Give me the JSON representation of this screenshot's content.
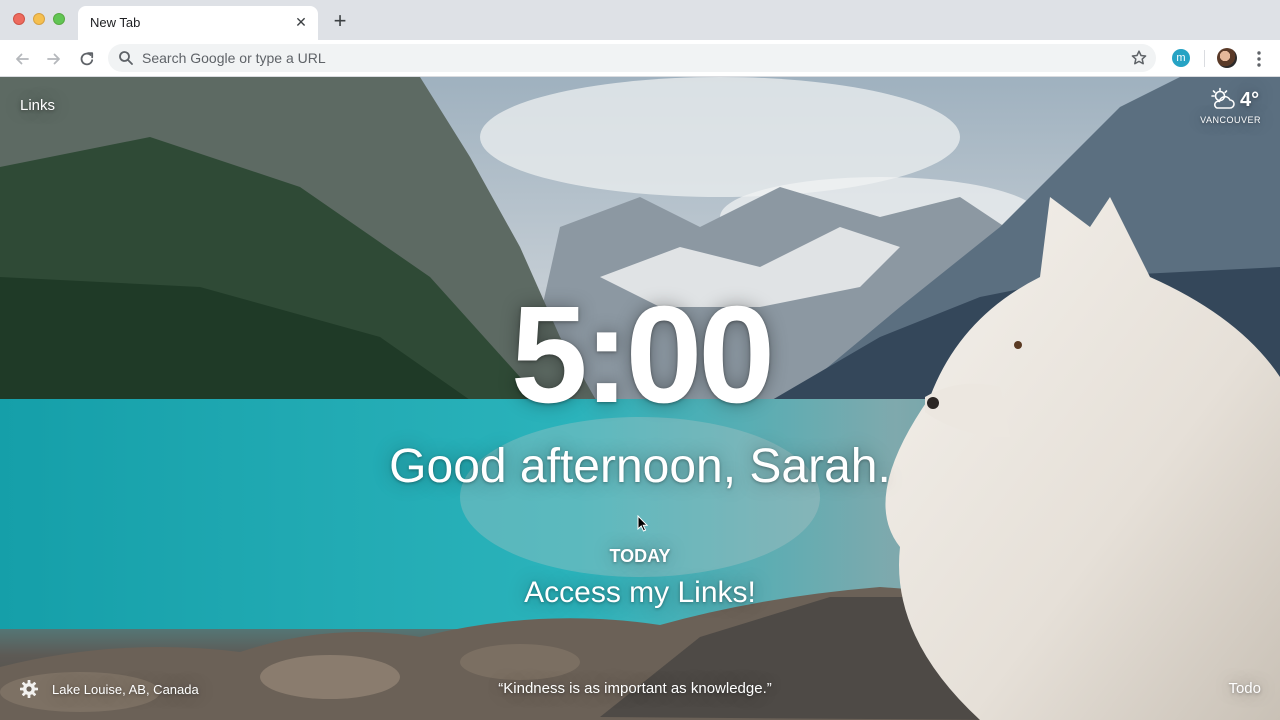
{
  "browser": {
    "tab_title": "New Tab",
    "tab_close_icon": "close-icon",
    "new_tab_icon": "plus-icon",
    "omnibox_placeholder": "Search Google or type a URL",
    "extension_badge": "m",
    "colors": {
      "tabstrip": "#dee1e6",
      "toolbar": "#ffffff",
      "omnibox": "#f1f3f4",
      "extension": "#26a3c4"
    }
  },
  "ntp": {
    "links_label": "Links",
    "weather": {
      "icon": "partly-cloudy-icon",
      "temperature": "4°",
      "location": "VANCOUVER"
    },
    "clock": "5:00",
    "greeting": "Good afternoon, Sarah.",
    "focus": {
      "label": "TODAY",
      "text": "Access my Links!"
    },
    "photo_location": "Lake Louise, AB, Canada",
    "quote": "“Kindness is as important as knowledge.”",
    "todo_label": "Todo",
    "settings_icon": "gear-icon"
  }
}
